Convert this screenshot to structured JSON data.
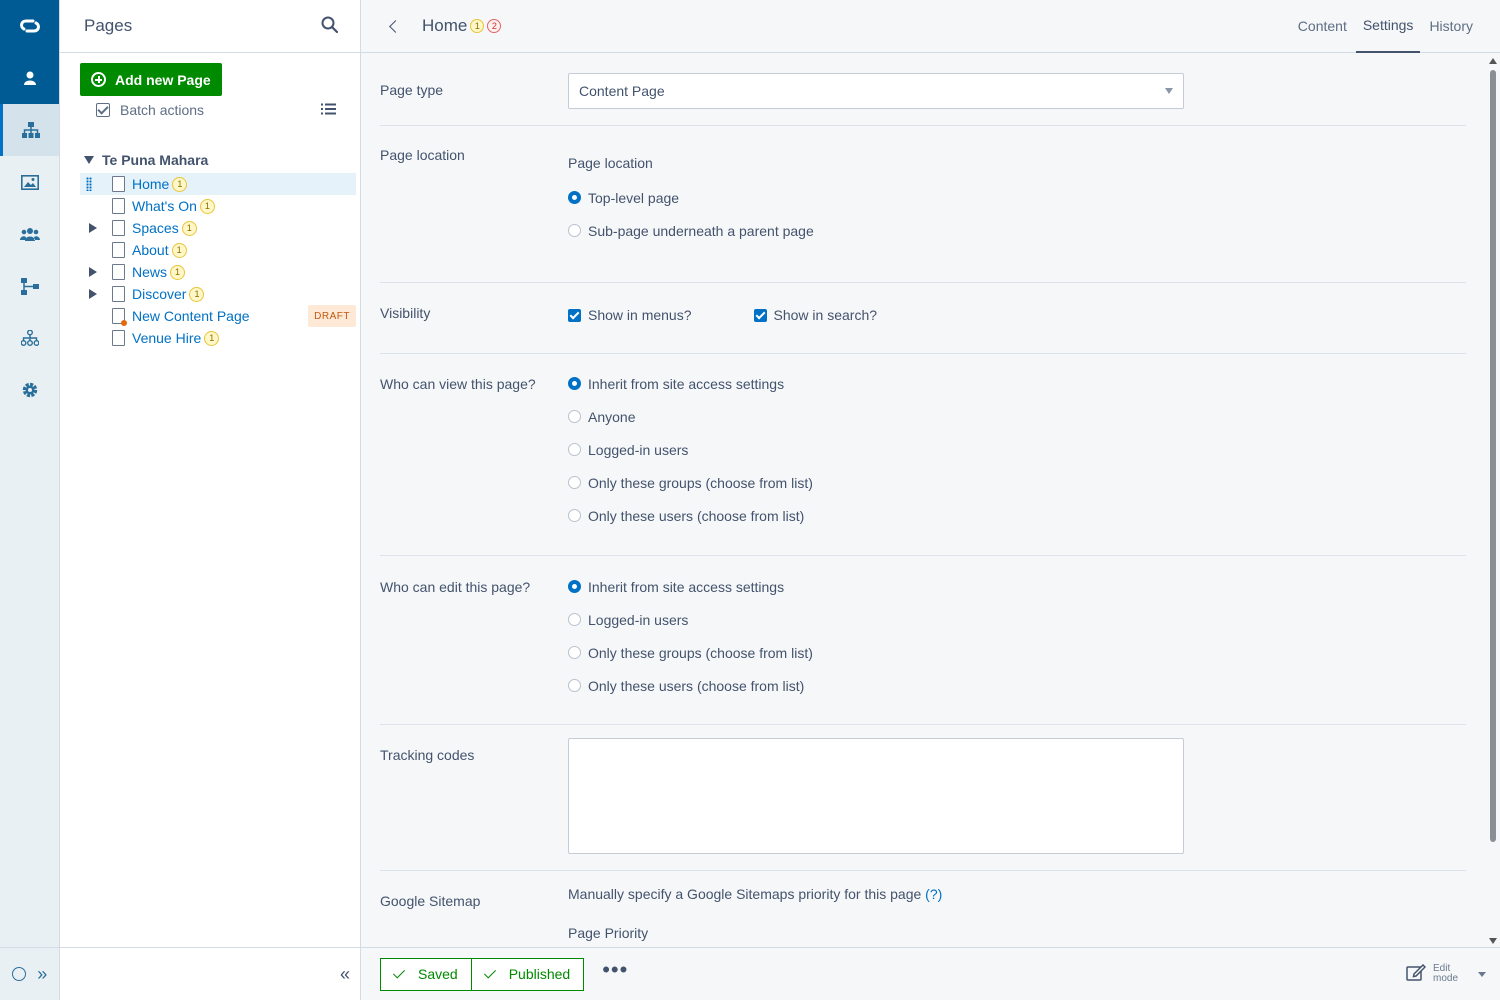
{
  "colors": {
    "brand": "#005b94",
    "accent": "#0071c4",
    "success": "#008a00",
    "draft": "#c05a0e"
  },
  "rail": {
    "items": [
      {
        "icon": "logo-icon"
      },
      {
        "icon": "user-icon"
      },
      {
        "icon": "sitetree-icon"
      },
      {
        "icon": "image-icon"
      },
      {
        "icon": "users-group-icon"
      },
      {
        "icon": "workflow-icon"
      },
      {
        "icon": "hierarchy-icon"
      },
      {
        "icon": "gear-icon"
      }
    ],
    "collapse_label": "»"
  },
  "tree_panel": {
    "title": "Pages",
    "add_button": "Add new Page",
    "batch_actions": "Batch actions",
    "root": "Te Puna Mahara",
    "nodes": [
      {
        "label": "Home",
        "badge": "1",
        "selected": true
      },
      {
        "label": "What's On",
        "badge": "1"
      },
      {
        "label": "Spaces",
        "badge": "1",
        "expandable": true
      },
      {
        "label": "About",
        "badge": "1"
      },
      {
        "label": "News",
        "badge": "1",
        "expandable": true
      },
      {
        "label": "Discover",
        "badge": "1",
        "expandable": true
      },
      {
        "label": "New Content Page",
        "status": "DRAFT"
      },
      {
        "label": "Venue Hire",
        "badge": "1"
      }
    ],
    "collapse_label": "«"
  },
  "main": {
    "title": "Home",
    "badge_1": "1",
    "badge_2": "2",
    "tabs": [
      "Content",
      "Settings",
      "History"
    ],
    "active_tab": "Settings"
  },
  "form": {
    "page_type": {
      "label": "Page type",
      "value": "Content Page"
    },
    "page_location": {
      "label": "Page location",
      "sublabel": "Page location",
      "options": [
        "Top-level page",
        "Sub-page underneath a parent page"
      ],
      "selected": 0
    },
    "visibility": {
      "label": "Visibility",
      "show_in_menus": "Show in menus?",
      "show_in_search": "Show in search?"
    },
    "who_can_view": {
      "label": "Who can view this page?",
      "options": [
        "Inherit from site access settings",
        "Anyone",
        "Logged-in users",
        "Only these groups (choose from list)",
        "Only these users (choose from list)"
      ],
      "selected": 0
    },
    "who_can_edit": {
      "label": "Who can edit this page?",
      "options": [
        "Inherit from site access settings",
        "Logged-in users",
        "Only these groups (choose from list)",
        "Only these users (choose from list)"
      ],
      "selected": 0
    },
    "tracking_codes": {
      "label": "Tracking codes",
      "value": ""
    },
    "google_sitemap": {
      "label": "Google Sitemap",
      "description": "Manually specify a Google Sitemaps priority for this page",
      "help": "(?)",
      "priority_label": "Page Priority"
    }
  },
  "footer": {
    "saved": "Saved",
    "published": "Published",
    "more": "•••",
    "edit_mode_line1": "Edit",
    "edit_mode_line2": "mode"
  }
}
